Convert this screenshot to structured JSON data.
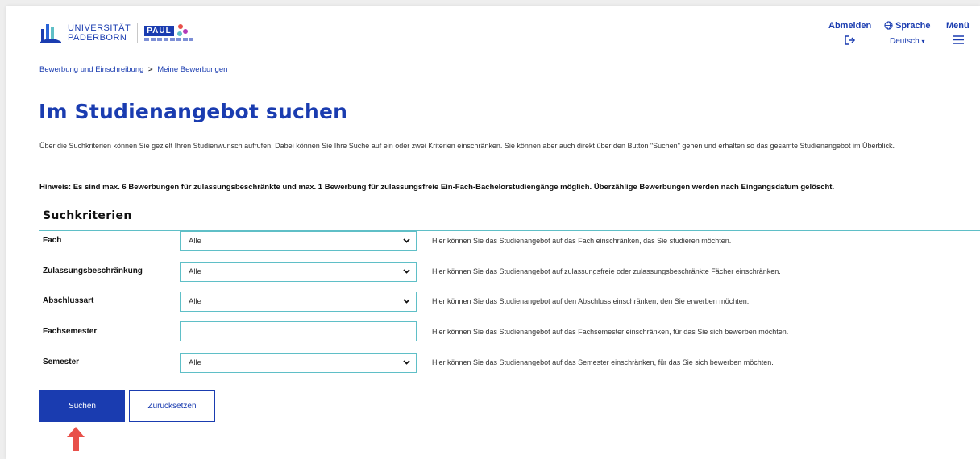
{
  "header": {
    "logo_line1": "UNIVERSITÄT",
    "logo_line2": "PADERBORN",
    "paul_label": "PAUL",
    "logout_label": "Abmelden",
    "logout_icon": "logout-icon",
    "language_label": "Sprache",
    "language_icon": "globe-icon",
    "language_value": "Deutsch",
    "menu_label": "Menü",
    "menu_icon": "hamburger-icon"
  },
  "breadcrumb": {
    "item1": "Bewerbung und Einschreibung",
    "separator": ">",
    "item2": "Meine Bewerbungen"
  },
  "page_title": "Im Studienangebot suchen",
  "intro_text": "Über die Suchkriterien können Sie gezielt Ihren Studienwunsch aufrufen. Dabei können Sie Ihre Suche auf ein oder zwei Kriterien einschränken. Sie können aber auch direkt über den Button \"Suchen\" gehen und erhalten so das gesamte Studienangebot im Überblick.",
  "hint_text": "Hinweis: Es sind max. 6 Bewerbungen für zulassungsbeschränkte und max. 1 Bewerbung für zulassungsfreie Ein-Fach-Bachelorstudiengänge möglich. Überzählige Bewerbungen werden nach Eingangsdatum gelöscht.",
  "criteria": {
    "heading": "Suchkriterien",
    "rows": [
      {
        "label": "Fach",
        "value": "Alle",
        "help": "Hier können Sie das Studienangebot auf das Fach einschränken, das Sie studieren möchten."
      },
      {
        "label": "Zulassungsbeschränkung",
        "value": "Alle",
        "help": "Hier können Sie das Studienangebot auf zulassungsfreie oder zulassungsbeschränkte Fächer einschränken."
      },
      {
        "label": "Abschlussart",
        "value": "Alle",
        "help": "Hier können Sie das Studienangebot auf den Abschluss einschränken, den Sie erwerben möchten."
      },
      {
        "label": "Fachsemester",
        "value": "",
        "help": "Hier können Sie das Studienangebot auf das Fachsemester einschränken, für das Sie sich bewerben möchten."
      },
      {
        "label": "Semester",
        "value": "Alle",
        "help": "Hier können Sie das Studienangebot auf das Semester einschränken, für das Sie sich bewerben möchten."
      }
    ]
  },
  "buttons": {
    "search": "Suchen",
    "reset": "Zurücksetzen"
  },
  "colors": {
    "brand": "#1a3cb0",
    "accent_border": "#5fbfc7",
    "pointer_arrow": "#e8504a"
  }
}
